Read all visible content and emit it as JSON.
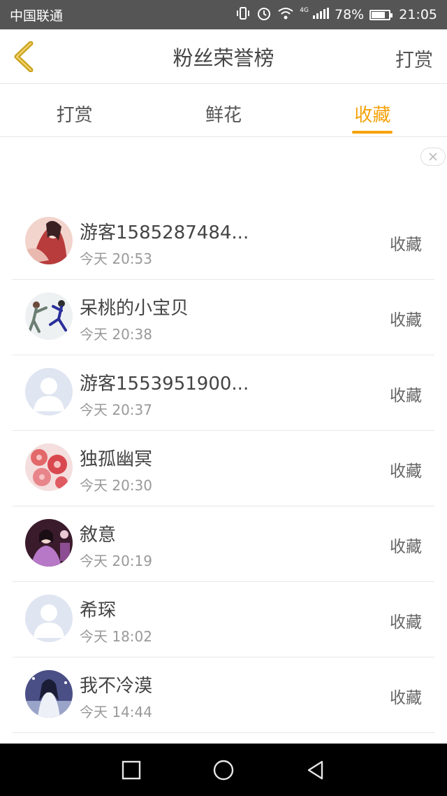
{
  "status": {
    "carrier": "中国联通",
    "network": "4G",
    "battery": "78%",
    "battery_level": 0.78,
    "time": "21:05"
  },
  "header": {
    "title": "粉丝荣誉榜",
    "action": "打赏"
  },
  "tabs": [
    {
      "label": "打赏",
      "active": false
    },
    {
      "label": "鲜花",
      "active": false
    },
    {
      "label": "收藏",
      "active": true
    }
  ],
  "accent_color": "#f5a20a",
  "list": [
    {
      "name": "游客1585287484...",
      "time": "今天 20:53",
      "action": "收藏",
      "avatar": "avatar-illustration-red"
    },
    {
      "name": "呆桃的小宝贝",
      "time": "今天 20:38",
      "action": "收藏",
      "avatar": "avatar-dancers"
    },
    {
      "name": "游客1553951900...",
      "time": "今天 20:37",
      "action": "收藏",
      "avatar": "avatar-default"
    },
    {
      "name": "独孤幽冥",
      "time": "今天 20:30",
      "action": "收藏",
      "avatar": "avatar-flowers"
    },
    {
      "name": "敘意",
      "time": "今天 20:19",
      "action": "收藏",
      "avatar": "avatar-woman-purple"
    },
    {
      "name": "希琛",
      "time": "今天 18:02",
      "action": "收藏",
      "avatar": "avatar-default"
    },
    {
      "name": "我不冷漠",
      "time": "今天 14:44",
      "action": "收藏",
      "avatar": "avatar-illustration-blue"
    }
  ]
}
